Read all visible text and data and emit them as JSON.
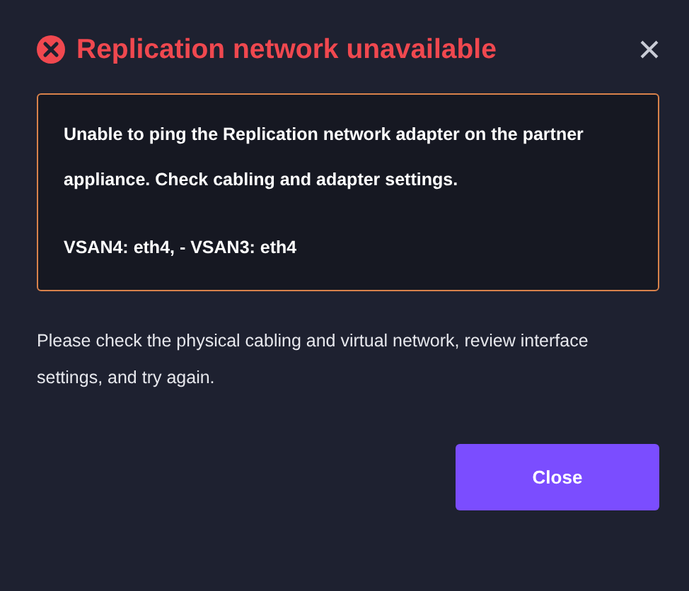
{
  "dialog": {
    "title": "Replication network unavailable",
    "error_box": {
      "message": "Unable to ping the Replication network adapter on the partner appliance. Check cabling and adapter settings.",
      "detail": "VSAN4: eth4, - VSAN3: eth4"
    },
    "instructions": "Please check the physical cabling and virtual network, review interface settings, and try again.",
    "buttons": [
      {
        "label": "Close",
        "kind": "primary"
      }
    ]
  }
}
